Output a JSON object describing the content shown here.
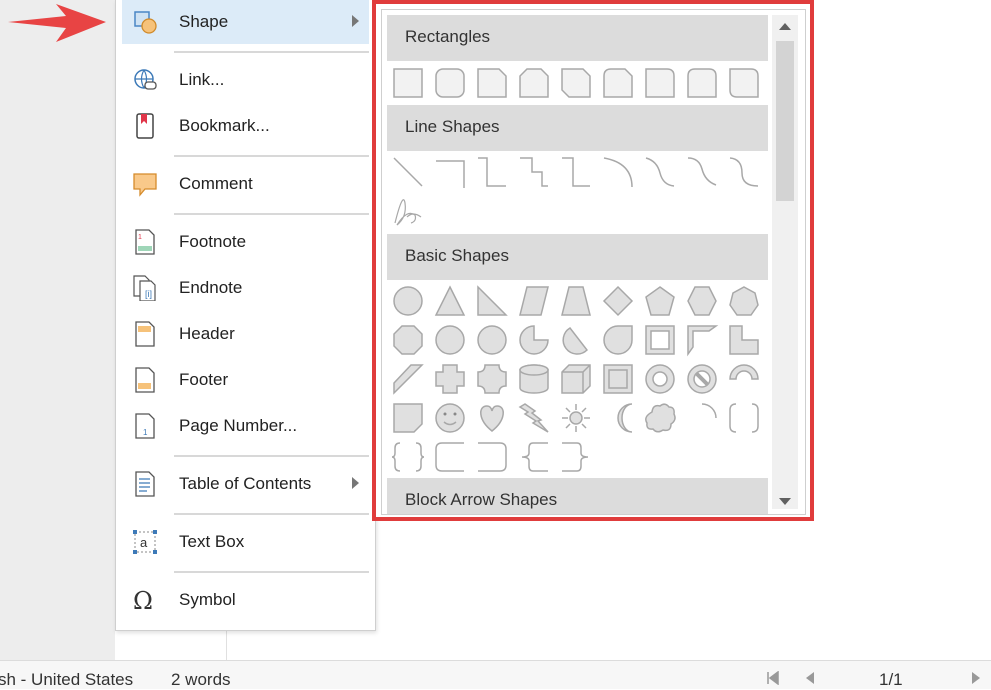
{
  "menu": {
    "items": [
      {
        "label": "Shape",
        "icon": "shape-icon",
        "submenu": true
      },
      {
        "label": "Link...",
        "icon": "link-icon"
      },
      {
        "label": "Bookmark...",
        "icon": "bookmark-icon"
      },
      {
        "label": "Comment",
        "icon": "comment-icon"
      },
      {
        "label": "Footnote",
        "icon": "footnote-icon"
      },
      {
        "label": "Endnote",
        "icon": "endnote-icon"
      },
      {
        "label": "Header",
        "icon": "header-icon"
      },
      {
        "label": "Footer",
        "icon": "footer-icon"
      },
      {
        "label": "Page Number...",
        "icon": "page-number-icon"
      },
      {
        "label": "Table of Contents",
        "icon": "table-of-contents-icon",
        "submenu": true
      },
      {
        "label": "Text Box",
        "icon": "text-box-icon"
      },
      {
        "label": "Symbol",
        "icon": "symbol-icon"
      }
    ]
  },
  "shapes_panel": {
    "categories": [
      {
        "label": "Rectangles"
      },
      {
        "label": "Line Shapes"
      },
      {
        "label": "Basic Shapes"
      },
      {
        "label": "Block Arrow Shapes"
      }
    ],
    "highlight_color": "#e03c3c",
    "shape_stroke_color": "#a8a8a8",
    "shape_fill_color": "#dedede"
  },
  "status_bar": {
    "language": "sh - United States",
    "word_count": "2 words",
    "page_indicator": "1/1"
  },
  "colors": {
    "arrow": "#e84444",
    "menu_active": "#dcebf8",
    "category_header": "#dcdcdc"
  }
}
